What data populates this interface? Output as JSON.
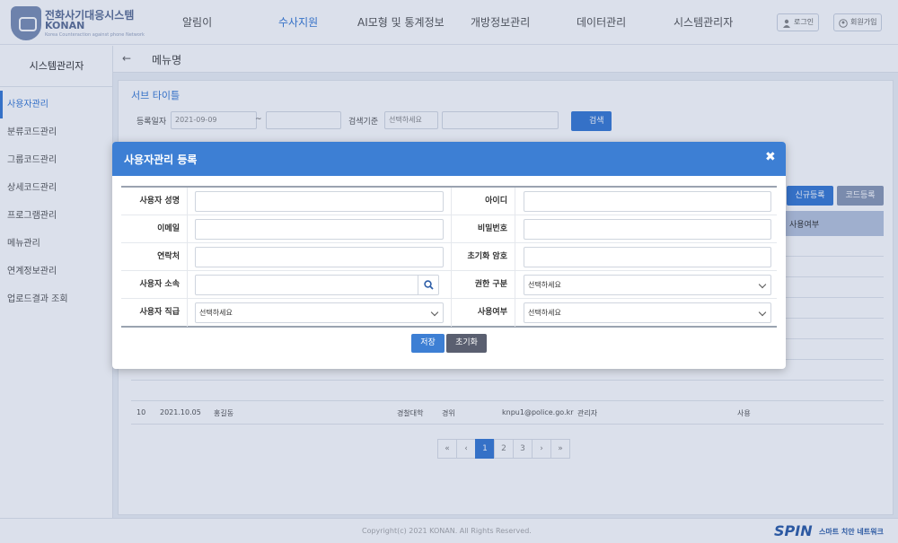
{
  "header": {
    "logo_title": "전화사기대응시스템",
    "logo_sub": "KONAN",
    "logo_tag": "Korea Counteraction against phone Network",
    "nav": [
      "알림이",
      "수사지원",
      "AI모형 및 통계정보",
      "개방정보관리",
      "데이터관리",
      "시스템관리자"
    ],
    "login": "로그인",
    "signup": "회원가입"
  },
  "sidebar": {
    "title": "시스템관리자",
    "items": [
      "사용자관리",
      "분류코드관리",
      "그룹코드관리",
      "상세코드관리",
      "프로그램관리",
      "메뉴관리",
      "연계정보관리",
      "업로드결과 조회"
    ]
  },
  "page": {
    "breadcrumb_title": "메뉴명",
    "sub_title": "서브 타이틀",
    "filter": {
      "date_label": "등록일자",
      "date_from": "2021-09-09",
      "tilde": "~",
      "date_to": "",
      "search_label": "검색기준",
      "search_select": "선택하세요",
      "search_button": "검색"
    },
    "new_button": "신규등록",
    "code_button": "코드등록",
    "table_header_last": "사용여부",
    "table_row": {
      "no": "10",
      "date": "2021.10.05",
      "name": "홍길동",
      "org": "경찰대학",
      "rank": "경위",
      "email": "knpu1@police.go.kr",
      "role": "관리자",
      "use": "사용"
    },
    "pagination": [
      "«",
      "‹",
      "1",
      "2",
      "3",
      "›",
      "»"
    ]
  },
  "modal": {
    "title": "사용자관리 등록",
    "close": "✖",
    "fields": {
      "name": "사용자 성명",
      "id": "아이디",
      "email": "이메일",
      "password": "비밀번호",
      "phone": "연락처",
      "reset_password": "초기화 암호",
      "org": "사용자 소속",
      "role": "권한 구분",
      "rank": "사용자 직급",
      "use": "사용여부"
    },
    "select_placeholder": "선택하세요",
    "save": "저장",
    "reset": "초기화"
  },
  "footer": {
    "copyright": "Copyright(c) 2021 KONAN. All Rights Reserved.",
    "brand": "SPIN",
    "brand_sub": "스마트 치안 네트워크"
  },
  "colors": {
    "accent": "#3d7fd4",
    "reset_button": "#5a5f70"
  }
}
